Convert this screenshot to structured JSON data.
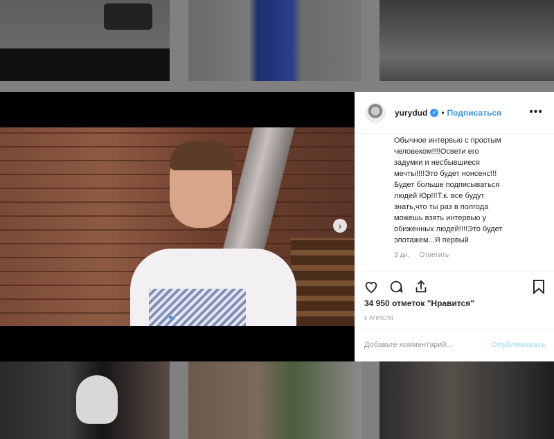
{
  "post": {
    "username": "yurydud",
    "separator": "•",
    "follow_label": "Подписаться",
    "more_label": "•••",
    "caption": "Обычное интервью с простым\nчеловеком!!!!Освети его\nзадумки и несбывшиеся\nмечты!!!!Это будет нонсенс!!!\nБудет больше подписываться\nлюдей Юр!!!Т.к. все будут\nзнать,что ты раз в полгода\nможешь взять интервью у\nобиженных людей!!!!Это будет\nэпотажем...Я первый",
    "comment_time": "3 дн.",
    "reply_label": "Ответить",
    "likes": "34 950 отметок \"Нравится\"",
    "date": "5 АПРЕЛЯ",
    "comment_placeholder": "Добавьте комментарий...",
    "publish_label": "Опубликовать"
  },
  "icons": {
    "verified": "verified-badge-icon",
    "like": "heart-icon",
    "comment": "comment-bubble-icon",
    "share": "share-icon",
    "save": "bookmark-icon",
    "next": "chevron-right-icon"
  },
  "carousel": {
    "current": 1,
    "total": 2
  },
  "colors": {
    "accent": "#3897f0",
    "publish_disabled": "#b2dffc"
  }
}
